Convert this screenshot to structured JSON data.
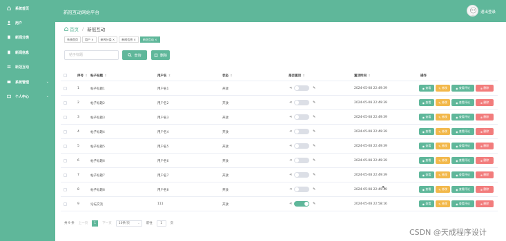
{
  "app_title": "新冠互动网站平台",
  "logout_label": "退出登录",
  "sidebar": {
    "items": [
      {
        "label": "系统首页",
        "icon": "home-icon"
      },
      {
        "label": "用户",
        "icon": "user-icon"
      },
      {
        "label": "新闻分类",
        "icon": "doc-icon"
      },
      {
        "label": "新闻信息",
        "icon": "doc-icon"
      },
      {
        "label": "新冠互动",
        "icon": "list-icon"
      },
      {
        "label": "系统管理",
        "icon": "grid-icon"
      },
      {
        "label": "个人中心",
        "icon": "card-icon"
      }
    ]
  },
  "breadcrumb": {
    "home": "首页",
    "current": "新冠互动"
  },
  "tags": [
    "系统首页",
    "用户 ×",
    "新闻分类 ×",
    "新闻信息 ×",
    "新冠互动 ×"
  ],
  "search": {
    "placeholder": "帖子标题",
    "query_label": "查询",
    "delete_label": "删除"
  },
  "table": {
    "headers": {
      "index": "序号",
      "title": "帖子标题",
      "username": "用户名",
      "status": "状态",
      "top": "是否置顶",
      "time": "置顶时间",
      "ops": "操作"
    },
    "rows": [
      {
        "index": "1",
        "title": "帖子标题1",
        "username": "用户名1",
        "status": "开放",
        "top": false,
        "time": "2024-05-08 22:49:39"
      },
      {
        "index": "2",
        "title": "帖子标题2",
        "username": "用户名2",
        "status": "开放",
        "top": false,
        "time": "2024-05-08 22:49:39"
      },
      {
        "index": "3",
        "title": "帖子标题3",
        "username": "用户名3",
        "status": "开放",
        "top": false,
        "time": "2024-05-08 22:49:39"
      },
      {
        "index": "4",
        "title": "帖子标题4",
        "username": "用户名4",
        "status": "开放",
        "top": false,
        "time": "2024-05-08 22:49:39"
      },
      {
        "index": "5",
        "title": "帖子标题5",
        "username": "用户名5",
        "status": "开放",
        "top": false,
        "time": "2024-05-08 22:49:39"
      },
      {
        "index": "6",
        "title": "帖子标题6",
        "username": "用户名6",
        "status": "开放",
        "top": false,
        "time": "2024-05-08 22:49:39"
      },
      {
        "index": "7",
        "title": "帖子标题7",
        "username": "用户名7",
        "status": "开放",
        "top": false,
        "time": "2024-05-08 22:49:39"
      },
      {
        "index": "8",
        "title": "帖子标题8",
        "username": "用户名8",
        "status": "开放",
        "top": false,
        "time": "2024-05-08 22:49:39"
      },
      {
        "index": "9",
        "title": "论坛交流",
        "username": "111",
        "status": "开放",
        "top": true,
        "time": "2024-05-08 22:58:16"
      }
    ],
    "ops": {
      "view": "查看",
      "edit": "修改",
      "comment": "查看评论",
      "delete": "删除"
    }
  },
  "pagination": {
    "total": "共 9 条",
    "prev": "上一页",
    "page": "1",
    "next": "下一页",
    "size": "10条/页",
    "goto": "前往",
    "goto_page": "1",
    "page_unit": "页"
  },
  "watermark": "CSDN @天成程序设计",
  "colors": {
    "primary": "#5fb79a",
    "warning": "#f2b84b",
    "danger": "#f27c7c"
  }
}
